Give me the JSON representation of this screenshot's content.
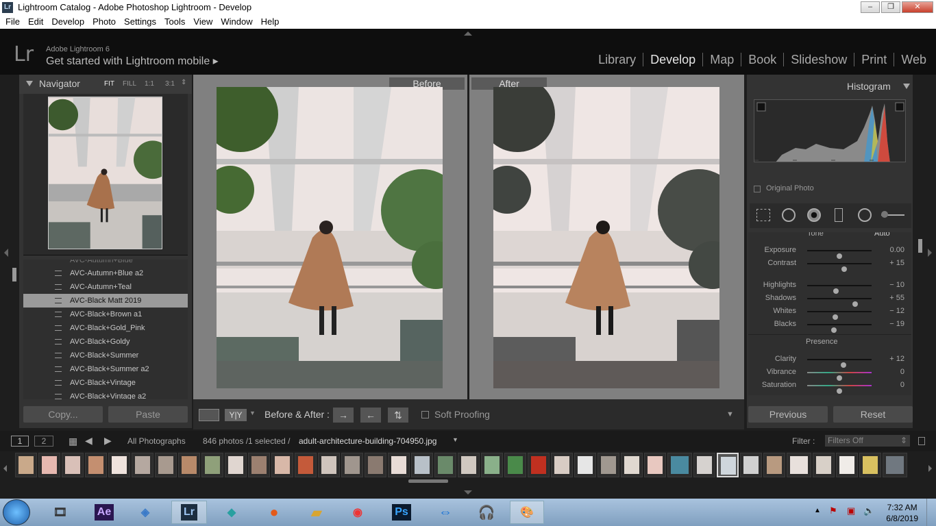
{
  "window": {
    "title": "Lightroom Catalog - Adobe Photoshop Lightroom - Develop",
    "app_icon": "Lr"
  },
  "menu": [
    "File",
    "Edit",
    "Develop",
    "Photo",
    "Settings",
    "Tools",
    "View",
    "Window",
    "Help"
  ],
  "identity": {
    "logo": "Lr",
    "version": "Adobe Lightroom 6",
    "mobile": "Get started with Lightroom mobile ▸"
  },
  "modules": [
    "Library",
    "Develop",
    "Map",
    "Book",
    "Slideshow",
    "Print",
    "Web"
  ],
  "navigator": {
    "title": "Navigator",
    "zoom": [
      "FIT",
      "FILL",
      "1:1",
      "3:1"
    ]
  },
  "presets": {
    "partial_top": "AVC-Autumn+Blue",
    "items": [
      "AVC-Autumn+Blue a2",
      "AVC-Autumn+Teal",
      "AVC-Black Matt 2019",
      "AVC-Black+Brown a1",
      "AVC-Black+Gold_Pink",
      "AVC-Black+Goldy",
      "AVC-Black+Summer",
      "AVC-Black+Summer a2",
      "AVC-Black+Vintage",
      "AVC-Black+Vintage a2"
    ],
    "selected_index": 2
  },
  "left_buttons": {
    "copy": "Copy...",
    "paste": "Paste"
  },
  "view": {
    "before": "Before",
    "after": "After"
  },
  "toolbar": {
    "yy": "Y|Y",
    "mode": "Before & After :",
    "soft_proofing": "Soft Proofing"
  },
  "histogram": {
    "title": "Histogram",
    "original_photo": "Original Photo"
  },
  "tone": {
    "header": "Tone",
    "auto": "Auto",
    "presence": "Presence",
    "sliders": [
      {
        "label": "Exposure",
        "value": "0.00",
        "pos": 0.5
      },
      {
        "label": "Contrast",
        "value": "+ 15",
        "pos": 0.57
      },
      {
        "label": "Highlights",
        "value": "− 10",
        "pos": 0.45
      },
      {
        "label": "Shadows",
        "value": "+ 55",
        "pos": 0.74
      },
      {
        "label": "Whites",
        "value": "− 12",
        "pos": 0.44
      },
      {
        "label": "Blacks",
        "value": "− 19",
        "pos": 0.41
      },
      {
        "label": "Clarity",
        "value": "+ 12",
        "pos": 0.56
      },
      {
        "label": "Vibrance",
        "value": "0",
        "pos": 0.5
      },
      {
        "label": "Saturation",
        "value": "0",
        "pos": 0.5
      }
    ]
  },
  "right_buttons": {
    "previous": "Previous",
    "reset": "Reset"
  },
  "filmstrip": {
    "page1": "1",
    "page2": "2",
    "source": "All Photographs",
    "count": "846 photos /1 selected /",
    "filename": "adult-architecture-building-704950.jpg",
    "filter_label": "Filter :",
    "filter_value": "Filters Off"
  },
  "taskbar": {
    "time": "7:32 AM",
    "date": "6/8/2019",
    "apps": [
      "film-icon",
      "Ae",
      "bluestack-icon",
      "Lr",
      "filmora-icon",
      "firefox-icon",
      "folder-icon",
      "camera-icon",
      "Ps",
      "teamviewer-icon",
      "audacity-icon",
      "paint-icon"
    ]
  },
  "colors": {
    "accent": "#e6e6e6",
    "lr_bg": "#0e0e0e",
    "panel": "#333333"
  }
}
